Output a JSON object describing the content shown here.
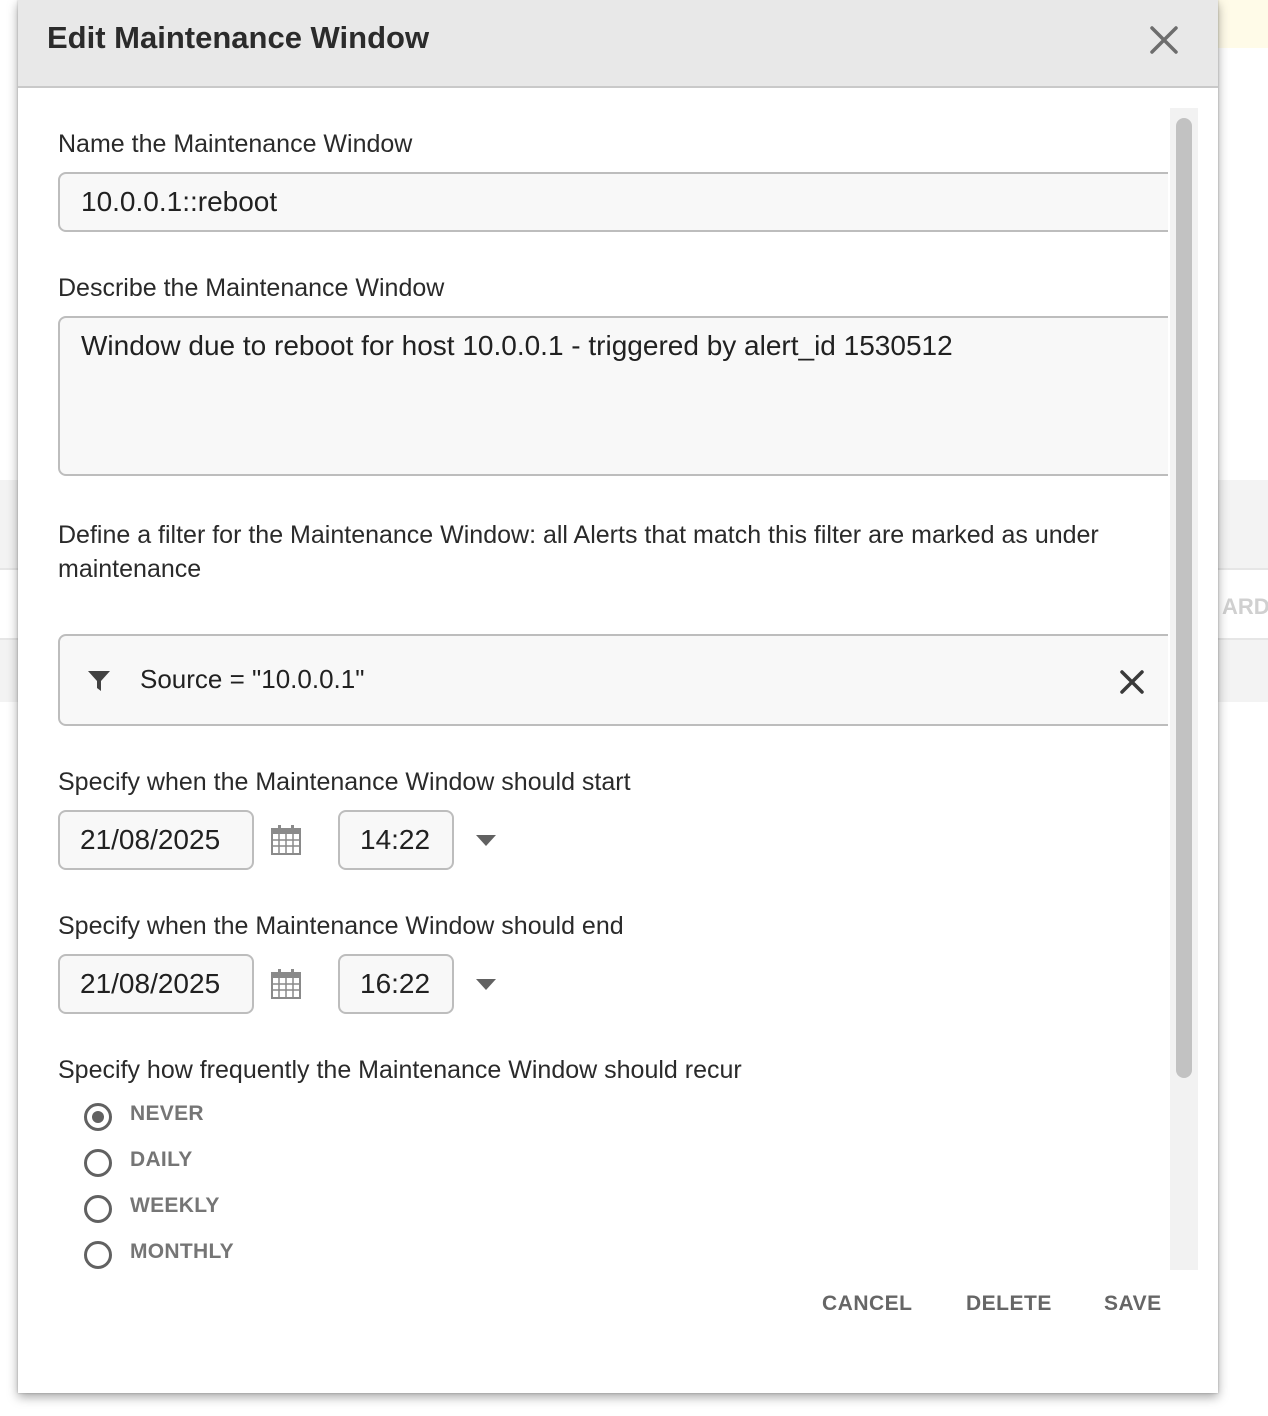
{
  "dialog": {
    "title": "Edit Maintenance Window",
    "close_icon": "close-icon"
  },
  "name_section": {
    "label": "Name the Maintenance Window",
    "value": "10.0.0.1::reboot"
  },
  "description_section": {
    "label": "Describe the Maintenance Window",
    "value": "Window due to reboot for host 10.0.0.1 - triggered by alert_id 1530512"
  },
  "filter_section": {
    "label": "Define a filter for the Maintenance Window: all Alerts that match this filter are marked as under maintenance",
    "filter_icon": "filter-icon",
    "expression": "Source = \"10.0.0.1\"",
    "clear_icon": "close-icon"
  },
  "start_section": {
    "label": "Specify when the Maintenance Window should start",
    "date": "21/08/2025",
    "time": "14:22"
  },
  "end_section": {
    "label": "Specify when the Maintenance Window should end",
    "date": "21/08/2025",
    "time": "16:22"
  },
  "recurrence_section": {
    "label": "Specify how frequently the Maintenance Window should recur",
    "options": [
      {
        "label": "NEVER",
        "selected": true
      },
      {
        "label": "DAILY",
        "selected": false
      },
      {
        "label": "WEEKLY",
        "selected": false
      },
      {
        "label": "MONTHLY",
        "selected": false
      }
    ]
  },
  "actions": {
    "cancel": "CANCEL",
    "delete": "DELETE",
    "save": "SAVE"
  },
  "background": {
    "partial_button_text": "ARD"
  },
  "colors": {
    "header_bg": "#e8e8e8",
    "field_border": "#bdbdbd",
    "field_bg": "#f8f8f8",
    "button_text": "#666666"
  }
}
